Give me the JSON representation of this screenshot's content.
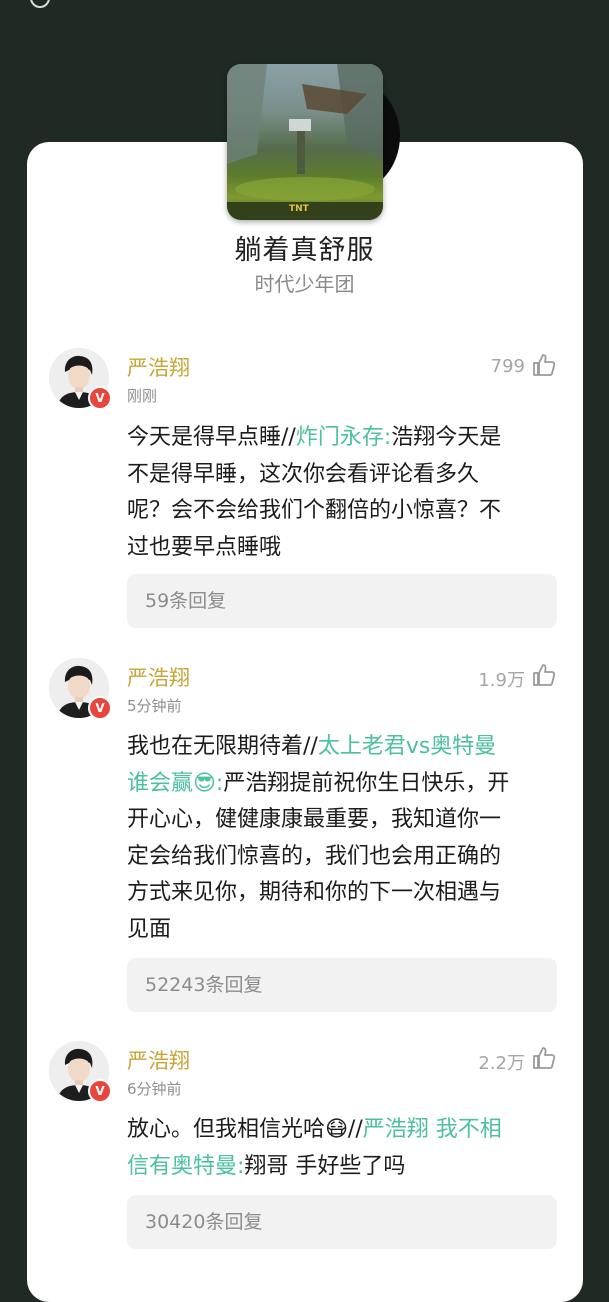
{
  "song": {
    "title": "躺着真舒服",
    "artist": "时代少年团",
    "cover_logo": "TNT"
  },
  "comments": [
    {
      "user": "严浩翔",
      "time": "刚刚",
      "likes": "799",
      "text_lines": [
        [
          {
            "t": "今天是得早点睡//"
          },
          {
            "t": "炸门永存:",
            "m": true
          },
          {
            "t": "浩翔今天是"
          }
        ],
        [
          {
            "t": "不是得早睡，这次你会看评论看多久"
          }
        ],
        [
          {
            "t": "呢？会不会给我们个翻倍的小惊喜？不"
          }
        ],
        [
          {
            "t": "过也要早点睡哦"
          }
        ]
      ],
      "replies": "59条回复"
    },
    {
      "user": "严浩翔",
      "time": "5分钟前",
      "likes": "1.9万",
      "text_lines": [
        [
          {
            "t": "我也在无限期待着//"
          },
          {
            "t": "太上老君vs奥特曼",
            "m": true
          }
        ],
        [
          {
            "t": "谁会赢😎:",
            "m": true
          },
          {
            "t": "严浩翔提前祝你生日快乐，开"
          }
        ],
        [
          {
            "t": "开心心，健健康康最重要，我知道你一"
          }
        ],
        [
          {
            "t": "定会给我们惊喜的，我们也会用正确的"
          }
        ],
        [
          {
            "t": "方式来见你，期待和你的下一次相遇与"
          }
        ],
        [
          {
            "t": "见面"
          }
        ]
      ],
      "replies": "52243条回复"
    },
    {
      "user": "严浩翔",
      "time": "6分钟前",
      "likes": "2.2万",
      "text_lines": [
        [
          {
            "t": "放心。但我相信光哈😷//"
          },
          {
            "t": "严浩翔 我不相",
            "m": true
          }
        ],
        [
          {
            "t": "信有奥特曼:",
            "m": true
          },
          {
            "t": "翔哥 手好些了吗"
          }
        ]
      ],
      "replies": "30420条回复"
    }
  ],
  "icons": {
    "like": "thumbs-up-icon",
    "verified": "verified-v-badge",
    "verified_label": "V"
  },
  "colors": {
    "background": "#1f2a25",
    "username": "#c9a437",
    "mention": "#4cc0a0",
    "verified": "#e8453c"
  }
}
